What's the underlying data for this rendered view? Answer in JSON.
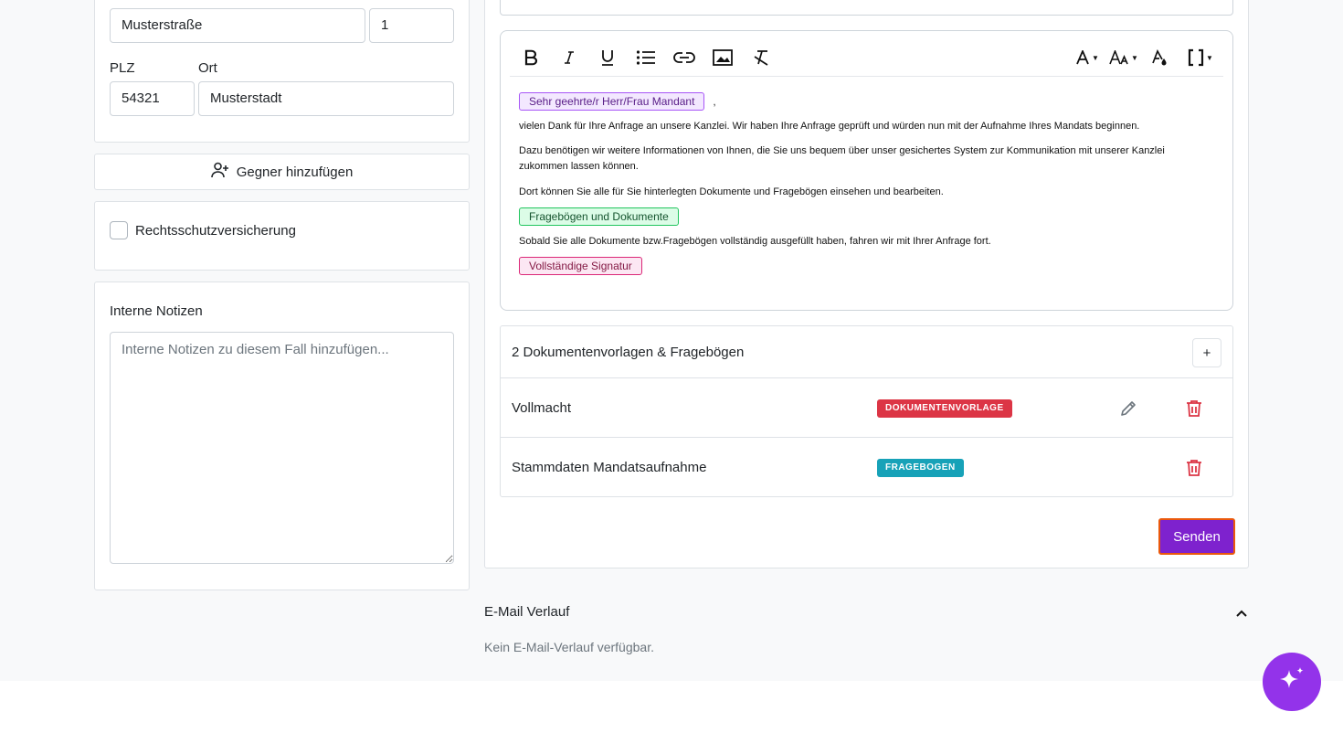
{
  "address": {
    "street": "Musterstraße",
    "house_number": "1",
    "plz_label": "PLZ",
    "plz": "54321",
    "ort_label": "Ort",
    "ort": "Musterstadt"
  },
  "add_opponent_label": "Gegner hinzufügen",
  "insurance": {
    "label": "Rechtsschutzversicherung",
    "checked": false
  },
  "notes": {
    "title": "Interne Notizen",
    "placeholder": "Interne Notizen zu diesem Fall hinzufügen..."
  },
  "editor": {
    "toolbar": [
      "bold-icon",
      "italic-icon",
      "underline-icon",
      "bullet-list-icon",
      "link-icon",
      "image-icon",
      "clear-format-icon",
      "font-color-icon",
      "font-size-icon",
      "highlight-icon",
      "placeholder-brackets-icon"
    ],
    "salutation_chip": "Sehr geehrte/r Herr/Frau Mandant",
    "salutation_suffix": ",",
    "para1": "vielen Dank für Ihre Anfrage an unsere Kanzlei. Wir haben Ihre Anfrage geprüft und würden nun mit der Aufnahme Ihres Mandats beginnen.",
    "para2": "Dazu benötigen wir weitere Informationen von Ihnen, die Sie uns bequem über unser gesichertes System zur Kommunikation mit unserer Kanzlei zukommen lassen können.",
    "para3": "Dort können Sie alle für Sie hinterlegten Dokumente und Fragebögen einsehen und bearbeiten.",
    "docs_chip": "Fragebögen und Dokumente",
    "para4": "Sobald Sie alle Dokumente bzw.Fragebögen vollständig ausgefüllt haben, fahren wir mit Ihrer Anfrage fort.",
    "signature_chip": "Vollständige Signatur"
  },
  "documents": {
    "title": "2 Dokumentenvorlagen & Fragebögen",
    "add_label": "+",
    "items": [
      {
        "name": "Vollmacht",
        "badge": "DOKUMENTENVORLAGE",
        "badge_color": "#dc3545"
      },
      {
        "name": "Stammdaten Mandatsaufnahme",
        "badge": "FRAGEBOGEN",
        "badge_color": "#17a2b8"
      }
    ]
  },
  "send_label": "Senden",
  "email_history": {
    "title": "E-Mail Verlauf",
    "empty": "Kein E-Mail-Verlauf verfügbar."
  },
  "colors": {
    "accent": "#7e22ce",
    "fab": "#9333ea",
    "danger": "#dc3545"
  }
}
